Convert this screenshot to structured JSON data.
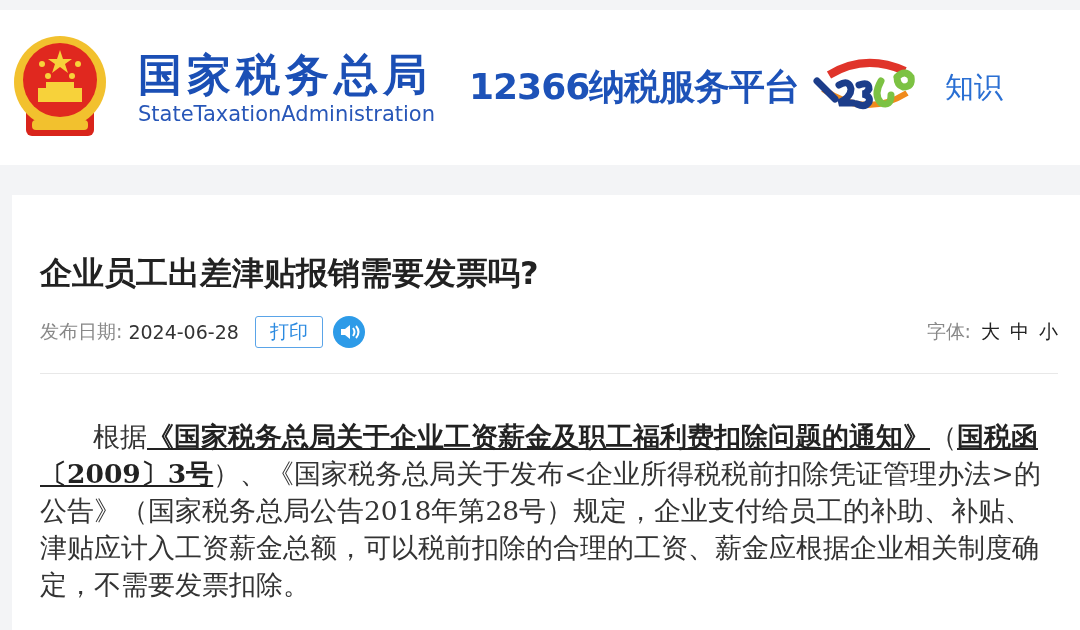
{
  "header": {
    "agency_name": "国家税务总局",
    "agency_name_en": "StateTaxationAdministration",
    "platform_name": "12366纳税服务平台",
    "nav_item": "知识"
  },
  "article": {
    "title": "企业员工出差津贴报销需要发票吗?",
    "date_label": "发布日期:",
    "date": "2024-06-28",
    "print_button": "打印",
    "font_label": "字体:",
    "font_sizes": [
      {
        "label": "大"
      },
      {
        "label": "中"
      },
      {
        "label": "小"
      }
    ],
    "body": "根据**《国家税务总局关于企业工资薪金及职工福利费扣除问题的通知》**（**国税函〔2009〕3号**）、《国家税务总局关于发布<企业所得税税前扣除凭证管理办法>的公告》（国家税务总局公告2018年第28号）规定，企业支付给员工的补助、补贴、津贴应计入工资薪金总额，可以税前扣除的合理的工资、薪金应根据企业相关制度确定，不需要发票扣除。"
  }
}
